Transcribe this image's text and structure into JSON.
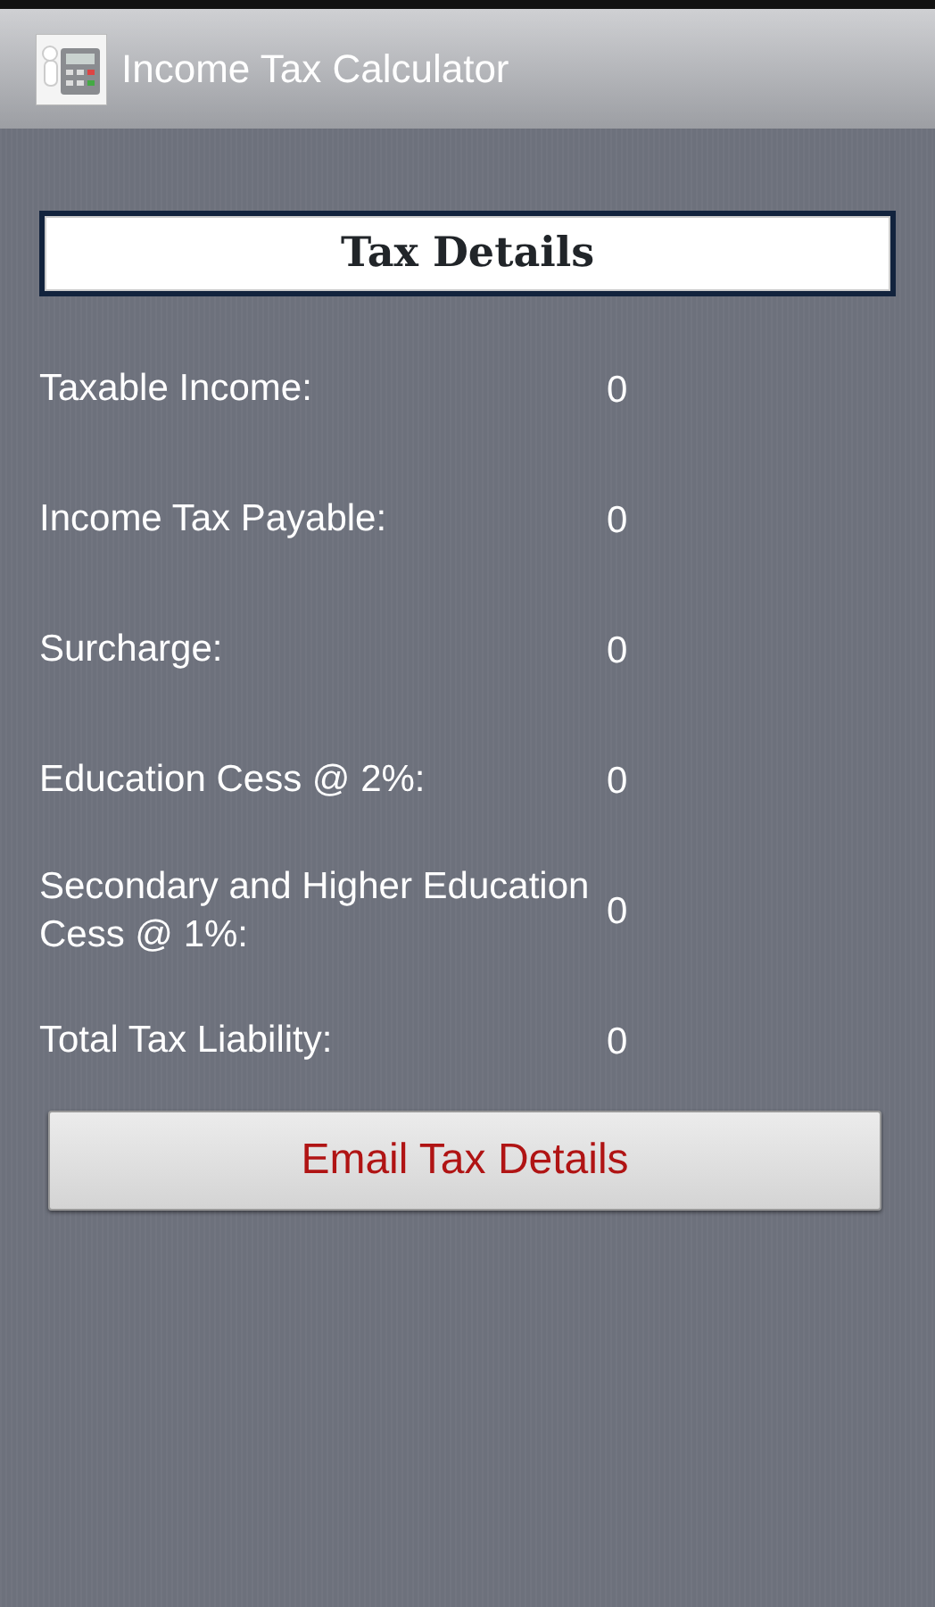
{
  "app_bar": {
    "title": "Income Tax Calculator"
  },
  "heading": "Tax Details",
  "rows": [
    {
      "label": "Taxable Income:",
      "value": "0"
    },
    {
      "label": "Income Tax Payable:",
      "value": "0"
    },
    {
      "label": "Surcharge:",
      "value": "0"
    },
    {
      "label": "Education Cess @ 2%:",
      "value": "0"
    },
    {
      "label": "Secondary and Higher Education Cess @ 1%:",
      "value": "0"
    },
    {
      "label": "Total Tax Liability:",
      "value": "0"
    }
  ],
  "button": "Email Tax Details"
}
